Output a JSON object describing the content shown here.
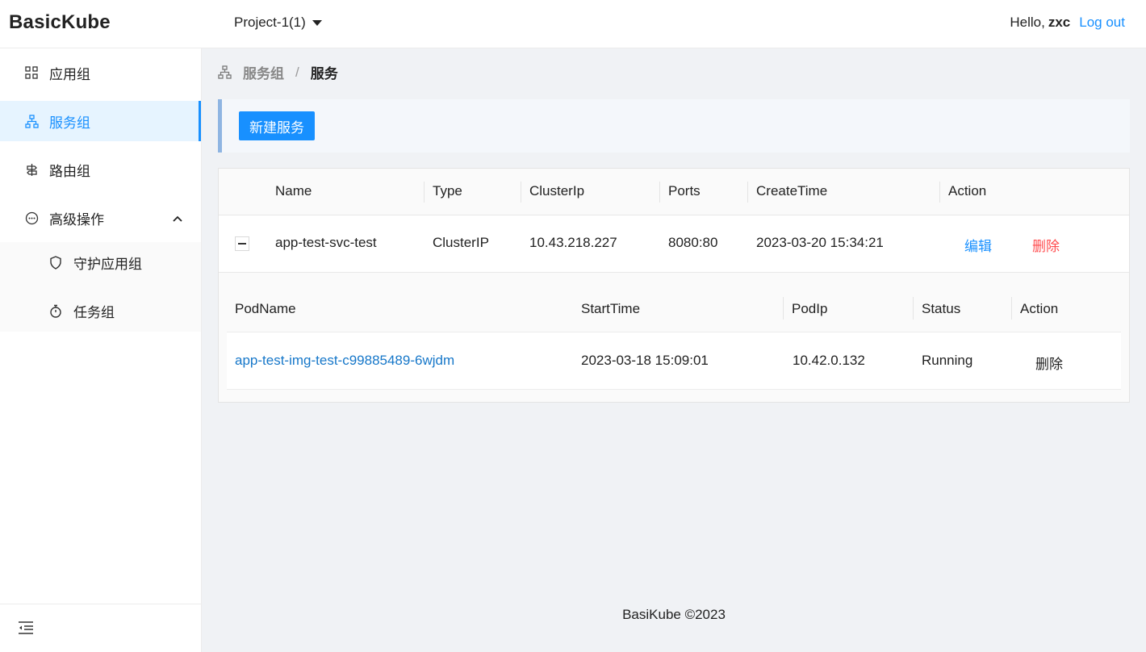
{
  "header": {
    "brand": "BasicKube",
    "project": "Project-1(1)",
    "greeting": "Hello,",
    "username": "zxc",
    "logout": "Log out"
  },
  "sidebar": {
    "items": [
      {
        "label": "应用组",
        "icon": "grid-icon"
      },
      {
        "label": "服务组",
        "icon": "cluster-icon",
        "active": true
      },
      {
        "label": "路由组",
        "icon": "route-icon"
      },
      {
        "label": "高级操作",
        "icon": "more-circle-icon",
        "expanded": true
      }
    ],
    "subitems": [
      {
        "label": "守护应用组",
        "icon": "shield-icon"
      },
      {
        "label": "任务组",
        "icon": "stopwatch-icon"
      }
    ]
  },
  "breadcrumb": {
    "parent": "服务组",
    "separator": "/",
    "current": "服务"
  },
  "toolbar": {
    "new_service": "新建服务"
  },
  "table": {
    "columns": [
      "Name",
      "Type",
      "ClusterIp",
      "Ports",
      "CreateTime",
      "Action"
    ],
    "row": {
      "name": "app-test-svc-test",
      "type": "ClusterIP",
      "cluster_ip": "10.43.218.227",
      "ports": "8080:80",
      "create_time": "2023-03-20 15:34:21",
      "edit": "编辑",
      "delete": "删除"
    },
    "pods": {
      "columns": [
        "PodName",
        "StartTime",
        "PodIp",
        "Status",
        "Action"
      ],
      "row": {
        "pod_name": "app-test-img-test-c99885489-6wjdm",
        "start_time": "2023-03-18 15:09:01",
        "pod_ip": "10.42.0.132",
        "status": "Running",
        "delete": "删除"
      }
    }
  },
  "footer": {
    "text": "BasiKube ©2023"
  },
  "colors": {
    "accent": "#1890ff",
    "danger": "#ff4d4f",
    "page_bg": "#f0f2f5"
  }
}
